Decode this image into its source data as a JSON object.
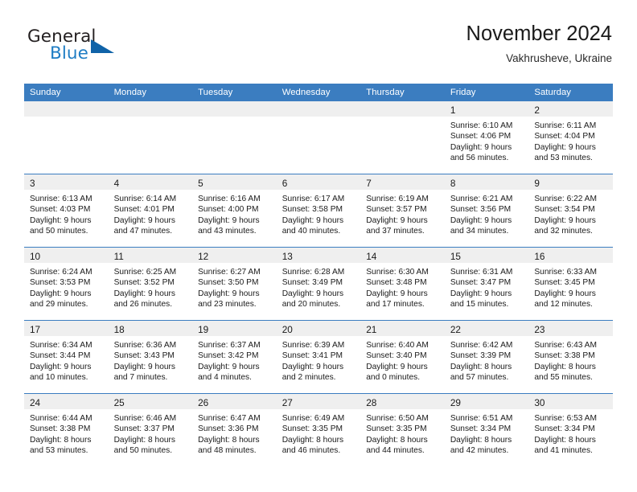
{
  "brand": {
    "line1": "General",
    "line2": "Blue",
    "flag_icon": "blue-triangle-flag-icon",
    "flag_color": "#1063a8",
    "text_color": "#231f20",
    "accent_color": "#1f7dc4"
  },
  "header": {
    "title": "November 2024",
    "subtitle": "Vakhrusheve, Ukraine"
  },
  "theme": {
    "header_bg": "#3b7dc0",
    "header_text": "#ffffff",
    "daynum_strip_bg": "#efefef",
    "cell_bg": "#ffffff",
    "row_divider": "#3b7dc0",
    "body_text": "#1a1a1a"
  },
  "weekday_headers": [
    "Sunday",
    "Monday",
    "Tuesday",
    "Wednesday",
    "Thursday",
    "Friday",
    "Saturday"
  ],
  "weeks": [
    [
      {
        "empty": true
      },
      {
        "empty": true
      },
      {
        "empty": true
      },
      {
        "empty": true
      },
      {
        "empty": true
      },
      {
        "empty": false,
        "day": "1",
        "sunrise": "Sunrise: 6:10 AM",
        "sunset": "Sunset: 4:06 PM",
        "daylight_line1": "Daylight: 9 hours",
        "daylight_line2": "and 56 minutes."
      },
      {
        "empty": false,
        "day": "2",
        "sunrise": "Sunrise: 6:11 AM",
        "sunset": "Sunset: 4:04 PM",
        "daylight_line1": "Daylight: 9 hours",
        "daylight_line2": "and 53 minutes."
      }
    ],
    [
      {
        "empty": false,
        "day": "3",
        "sunrise": "Sunrise: 6:13 AM",
        "sunset": "Sunset: 4:03 PM",
        "daylight_line1": "Daylight: 9 hours",
        "daylight_line2": "and 50 minutes."
      },
      {
        "empty": false,
        "day": "4",
        "sunrise": "Sunrise: 6:14 AM",
        "sunset": "Sunset: 4:01 PM",
        "daylight_line1": "Daylight: 9 hours",
        "daylight_line2": "and 47 minutes."
      },
      {
        "empty": false,
        "day": "5",
        "sunrise": "Sunrise: 6:16 AM",
        "sunset": "Sunset: 4:00 PM",
        "daylight_line1": "Daylight: 9 hours",
        "daylight_line2": "and 43 minutes."
      },
      {
        "empty": false,
        "day": "6",
        "sunrise": "Sunrise: 6:17 AM",
        "sunset": "Sunset: 3:58 PM",
        "daylight_line1": "Daylight: 9 hours",
        "daylight_line2": "and 40 minutes."
      },
      {
        "empty": false,
        "day": "7",
        "sunrise": "Sunrise: 6:19 AM",
        "sunset": "Sunset: 3:57 PM",
        "daylight_line1": "Daylight: 9 hours",
        "daylight_line2": "and 37 minutes."
      },
      {
        "empty": false,
        "day": "8",
        "sunrise": "Sunrise: 6:21 AM",
        "sunset": "Sunset: 3:56 PM",
        "daylight_line1": "Daylight: 9 hours",
        "daylight_line2": "and 34 minutes."
      },
      {
        "empty": false,
        "day": "9",
        "sunrise": "Sunrise: 6:22 AM",
        "sunset": "Sunset: 3:54 PM",
        "daylight_line1": "Daylight: 9 hours",
        "daylight_line2": "and 32 minutes."
      }
    ],
    [
      {
        "empty": false,
        "day": "10",
        "sunrise": "Sunrise: 6:24 AM",
        "sunset": "Sunset: 3:53 PM",
        "daylight_line1": "Daylight: 9 hours",
        "daylight_line2": "and 29 minutes."
      },
      {
        "empty": false,
        "day": "11",
        "sunrise": "Sunrise: 6:25 AM",
        "sunset": "Sunset: 3:52 PM",
        "daylight_line1": "Daylight: 9 hours",
        "daylight_line2": "and 26 minutes."
      },
      {
        "empty": false,
        "day": "12",
        "sunrise": "Sunrise: 6:27 AM",
        "sunset": "Sunset: 3:50 PM",
        "daylight_line1": "Daylight: 9 hours",
        "daylight_line2": "and 23 minutes."
      },
      {
        "empty": false,
        "day": "13",
        "sunrise": "Sunrise: 6:28 AM",
        "sunset": "Sunset: 3:49 PM",
        "daylight_line1": "Daylight: 9 hours",
        "daylight_line2": "and 20 minutes."
      },
      {
        "empty": false,
        "day": "14",
        "sunrise": "Sunrise: 6:30 AM",
        "sunset": "Sunset: 3:48 PM",
        "daylight_line1": "Daylight: 9 hours",
        "daylight_line2": "and 17 minutes."
      },
      {
        "empty": false,
        "day": "15",
        "sunrise": "Sunrise: 6:31 AM",
        "sunset": "Sunset: 3:47 PM",
        "daylight_line1": "Daylight: 9 hours",
        "daylight_line2": "and 15 minutes."
      },
      {
        "empty": false,
        "day": "16",
        "sunrise": "Sunrise: 6:33 AM",
        "sunset": "Sunset: 3:45 PM",
        "daylight_line1": "Daylight: 9 hours",
        "daylight_line2": "and 12 minutes."
      }
    ],
    [
      {
        "empty": false,
        "day": "17",
        "sunrise": "Sunrise: 6:34 AM",
        "sunset": "Sunset: 3:44 PM",
        "daylight_line1": "Daylight: 9 hours",
        "daylight_line2": "and 10 minutes."
      },
      {
        "empty": false,
        "day": "18",
        "sunrise": "Sunrise: 6:36 AM",
        "sunset": "Sunset: 3:43 PM",
        "daylight_line1": "Daylight: 9 hours",
        "daylight_line2": "and 7 minutes."
      },
      {
        "empty": false,
        "day": "19",
        "sunrise": "Sunrise: 6:37 AM",
        "sunset": "Sunset: 3:42 PM",
        "daylight_line1": "Daylight: 9 hours",
        "daylight_line2": "and 4 minutes."
      },
      {
        "empty": false,
        "day": "20",
        "sunrise": "Sunrise: 6:39 AM",
        "sunset": "Sunset: 3:41 PM",
        "daylight_line1": "Daylight: 9 hours",
        "daylight_line2": "and 2 minutes."
      },
      {
        "empty": false,
        "day": "21",
        "sunrise": "Sunrise: 6:40 AM",
        "sunset": "Sunset: 3:40 PM",
        "daylight_line1": "Daylight: 9 hours",
        "daylight_line2": "and 0 minutes."
      },
      {
        "empty": false,
        "day": "22",
        "sunrise": "Sunrise: 6:42 AM",
        "sunset": "Sunset: 3:39 PM",
        "daylight_line1": "Daylight: 8 hours",
        "daylight_line2": "and 57 minutes."
      },
      {
        "empty": false,
        "day": "23",
        "sunrise": "Sunrise: 6:43 AM",
        "sunset": "Sunset: 3:38 PM",
        "daylight_line1": "Daylight: 8 hours",
        "daylight_line2": "and 55 minutes."
      }
    ],
    [
      {
        "empty": false,
        "day": "24",
        "sunrise": "Sunrise: 6:44 AM",
        "sunset": "Sunset: 3:38 PM",
        "daylight_line1": "Daylight: 8 hours",
        "daylight_line2": "and 53 minutes."
      },
      {
        "empty": false,
        "day": "25",
        "sunrise": "Sunrise: 6:46 AM",
        "sunset": "Sunset: 3:37 PM",
        "daylight_line1": "Daylight: 8 hours",
        "daylight_line2": "and 50 minutes."
      },
      {
        "empty": false,
        "day": "26",
        "sunrise": "Sunrise: 6:47 AM",
        "sunset": "Sunset: 3:36 PM",
        "daylight_line1": "Daylight: 8 hours",
        "daylight_line2": "and 48 minutes."
      },
      {
        "empty": false,
        "day": "27",
        "sunrise": "Sunrise: 6:49 AM",
        "sunset": "Sunset: 3:35 PM",
        "daylight_line1": "Daylight: 8 hours",
        "daylight_line2": "and 46 minutes."
      },
      {
        "empty": false,
        "day": "28",
        "sunrise": "Sunrise: 6:50 AM",
        "sunset": "Sunset: 3:35 PM",
        "daylight_line1": "Daylight: 8 hours",
        "daylight_line2": "and 44 minutes."
      },
      {
        "empty": false,
        "day": "29",
        "sunrise": "Sunrise: 6:51 AM",
        "sunset": "Sunset: 3:34 PM",
        "daylight_line1": "Daylight: 8 hours",
        "daylight_line2": "and 42 minutes."
      },
      {
        "empty": false,
        "day": "30",
        "sunrise": "Sunrise: 6:53 AM",
        "sunset": "Sunset: 3:34 PM",
        "daylight_line1": "Daylight: 8 hours",
        "daylight_line2": "and 41 minutes."
      }
    ]
  ]
}
